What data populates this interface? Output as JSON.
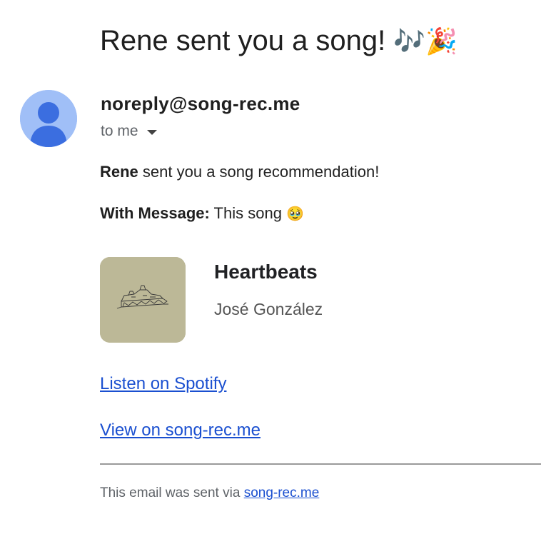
{
  "email": {
    "subject": "Rene sent you a song!",
    "subject_emoji": "🎶🎉",
    "sender": "noreply@song-rec.me",
    "recipient": "to me",
    "body": {
      "sender_name": "Rene",
      "intro_rest": " sent you a song recommendation!",
      "message_label": "With Message:",
      "message_text": " This song ",
      "message_emoji": "🥹"
    },
    "track": {
      "title": "Heartbeats",
      "artist": "José González",
      "cover_color": "#bcb897"
    },
    "links": {
      "spotify": "Listen on Spotify",
      "site": "View on song-rec.me"
    },
    "footer": {
      "prefix": "This email was sent via ",
      "link": "song-rec.me"
    }
  },
  "colors": {
    "avatar_bg": "#a0bff7",
    "avatar_fg": "#3b6ee0",
    "link": "#1a4fd0"
  },
  "icons": {
    "avatar": "person-icon",
    "dropdown": "caret-down-icon"
  }
}
